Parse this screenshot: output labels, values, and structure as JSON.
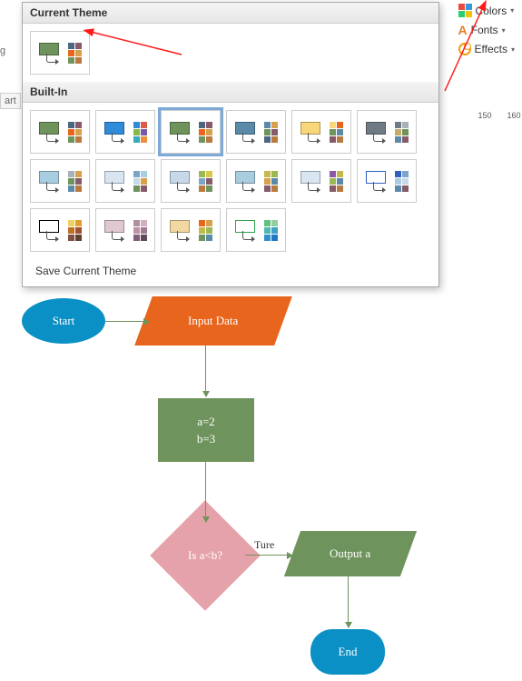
{
  "ribbon": {
    "colors_label": "Colors",
    "fonts_label": "Fonts",
    "effects_label": "Effects"
  },
  "left_fragments": {
    "g": "g",
    "art": "art"
  },
  "ruler_ticks": [
    "150",
    "160"
  ],
  "panel": {
    "current_header": "Current Theme",
    "builtin_header": "Built-In",
    "save_label": "Save Current Theme"
  },
  "themes": {
    "current": {
      "fill": "#6f935c",
      "swatches": [
        "#4b667e",
        "#865a6a",
        "#e8651d",
        "#d7a04a",
        "#6f935c",
        "#b9793f"
      ]
    },
    "builtin": [
      {
        "fill": "#6f935c",
        "swatches": [
          "#4b667e",
          "#865a6a",
          "#e8651d",
          "#d7a04a",
          "#6f935c",
          "#b9793f"
        ],
        "selected": false
      },
      {
        "fill": "#2f8bd8",
        "swatches": [
          "#2f8bd8",
          "#d85b4a",
          "#87b94a",
          "#7a5aa8",
          "#39a9bd",
          "#e8903a"
        ],
        "selected": false
      },
      {
        "fill": "#6f935c",
        "swatches": [
          "#4b667e",
          "#865a6a",
          "#e8651d",
          "#d7a04a",
          "#6f935c",
          "#b9793f"
        ],
        "selected": true
      },
      {
        "fill": "#5a8aa8",
        "swatches": [
          "#5a8aa8",
          "#d7a04a",
          "#6f935c",
          "#865a6a",
          "#4b667e",
          "#b9793f"
        ],
        "selected": false
      },
      {
        "fill": "#f7d77a",
        "swatches": [
          "#f7d77a",
          "#e8651d",
          "#6f935c",
          "#5a8aa8",
          "#865a6a",
          "#b9793f"
        ],
        "selected": false
      },
      {
        "fill": "#707a84",
        "swatches": [
          "#707a84",
          "#a8b0b8",
          "#c7a96a",
          "#6f935c",
          "#5a8aa8",
          "#865a6a"
        ],
        "selected": false
      },
      {
        "fill": "#a8cce0",
        "swatches": [
          "#a8b0b8",
          "#d7a04a",
          "#6f935c",
          "#865a6a",
          "#5a8aa8",
          "#b9793f"
        ],
        "selected": false
      },
      {
        "fill": "#d9e6f2",
        "swatches": [
          "#7aa5c9",
          "#a8cce0",
          "#c7d9e8",
          "#d7a04a",
          "#6f935c",
          "#865a6a"
        ],
        "selected": false
      },
      {
        "fill": "#c7d9e8",
        "swatches": [
          "#9ab953",
          "#d7c84a",
          "#7aa5c9",
          "#865a6a",
          "#b9793f",
          "#6f935c"
        ],
        "selected": false
      },
      {
        "fill": "#a8cce0",
        "swatches": [
          "#c6b84a",
          "#9ab953",
          "#d7a04a",
          "#5a8aa8",
          "#865a6a",
          "#b9793f"
        ],
        "selected": false
      },
      {
        "fill": "#d9e6f2",
        "swatches": [
          "#8a5aa8",
          "#c6b84a",
          "#9ab953",
          "#5a8aa8",
          "#865a6a",
          "#b9793f"
        ],
        "selected": false
      },
      {
        "fill": "#ffffff",
        "stroke": "#3060c0",
        "swatches": [
          "#3060c0",
          "#7aa5c9",
          "#a8cce0",
          "#c7d9e8",
          "#5a8aa8",
          "#865a6a"
        ],
        "selected": false
      },
      {
        "fill": "#ffffff",
        "stroke": "#000000",
        "swatches": [
          "#f0d060",
          "#e0a030",
          "#c07020",
          "#a05030",
          "#805040",
          "#604030"
        ],
        "selected": false
      },
      {
        "fill": "#e0c8d0",
        "swatches": [
          "#b090a0",
          "#d0b0c0",
          "#c090a8",
          "#a07890",
          "#806078",
          "#604860"
        ],
        "selected": false
      },
      {
        "fill": "#f0d8a0",
        "swatches": [
          "#e8651d",
          "#d7a04a",
          "#c6b84a",
          "#9ab953",
          "#6f935c",
          "#5a8aa8"
        ],
        "selected": false
      },
      {
        "fill": "#ffffff",
        "stroke": "#30a050",
        "swatches": [
          "#60c080",
          "#90d0a0",
          "#50b8b0",
          "#40a0c8",
          "#3090d0",
          "#2078c0"
        ],
        "selected": false
      }
    ]
  },
  "flowchart": {
    "start": "Start",
    "input": "Input Data",
    "process_l1": "a=2",
    "process_l2": "b=3",
    "decision": "Is a<b?",
    "decision_true": "Ture",
    "output": "Output a",
    "end": "End"
  }
}
